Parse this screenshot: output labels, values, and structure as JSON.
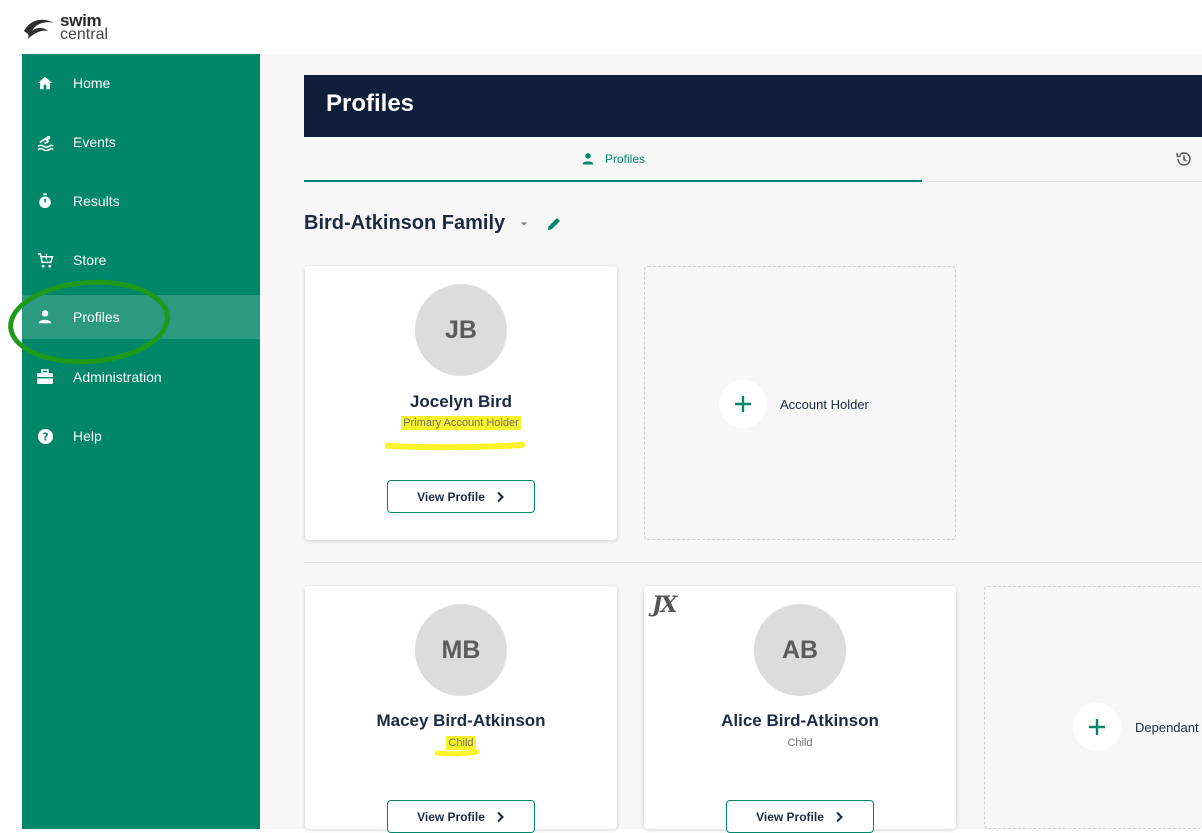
{
  "app": {
    "logo_line1": "swim",
    "logo_line2": "central"
  },
  "sidebar": {
    "items": [
      {
        "label": "Home",
        "icon": "home-icon"
      },
      {
        "label": "Events",
        "icon": "swimmer-icon"
      },
      {
        "label": "Results",
        "icon": "stopwatch-icon"
      },
      {
        "label": "Store",
        "icon": "cart-icon"
      },
      {
        "label": "Profiles",
        "icon": "person-icon",
        "active": true
      },
      {
        "label": "Administration",
        "icon": "briefcase-icon"
      },
      {
        "label": "Help",
        "icon": "help-icon"
      }
    ]
  },
  "header": {
    "title": "Profiles"
  },
  "tabs": {
    "profiles_label": "Profiles"
  },
  "family": {
    "name": "Bird-Atkinson Family"
  },
  "account_holders": [
    {
      "initials": "JB",
      "name": "Jocelyn Bird",
      "role": "Primary Account Holder",
      "button": "View Profile"
    }
  ],
  "add_account_holder_label": "Account Holder",
  "dependants": [
    {
      "initials": "MB",
      "name": "Macey Bird-Atkinson",
      "role": "Child",
      "button": "View Profile"
    },
    {
      "initials": "AB",
      "name": "Alice Bird-Atkinson",
      "role": "Child",
      "button": "View Profile",
      "badge": "JX"
    }
  ],
  "add_dependant_label": "Dependant",
  "colors": {
    "sidebar": "#00876a",
    "header": "#0f1e3b",
    "accent": "#00876a",
    "highlight": "#fbf32a",
    "annotation_circle": "#1e9a18"
  }
}
